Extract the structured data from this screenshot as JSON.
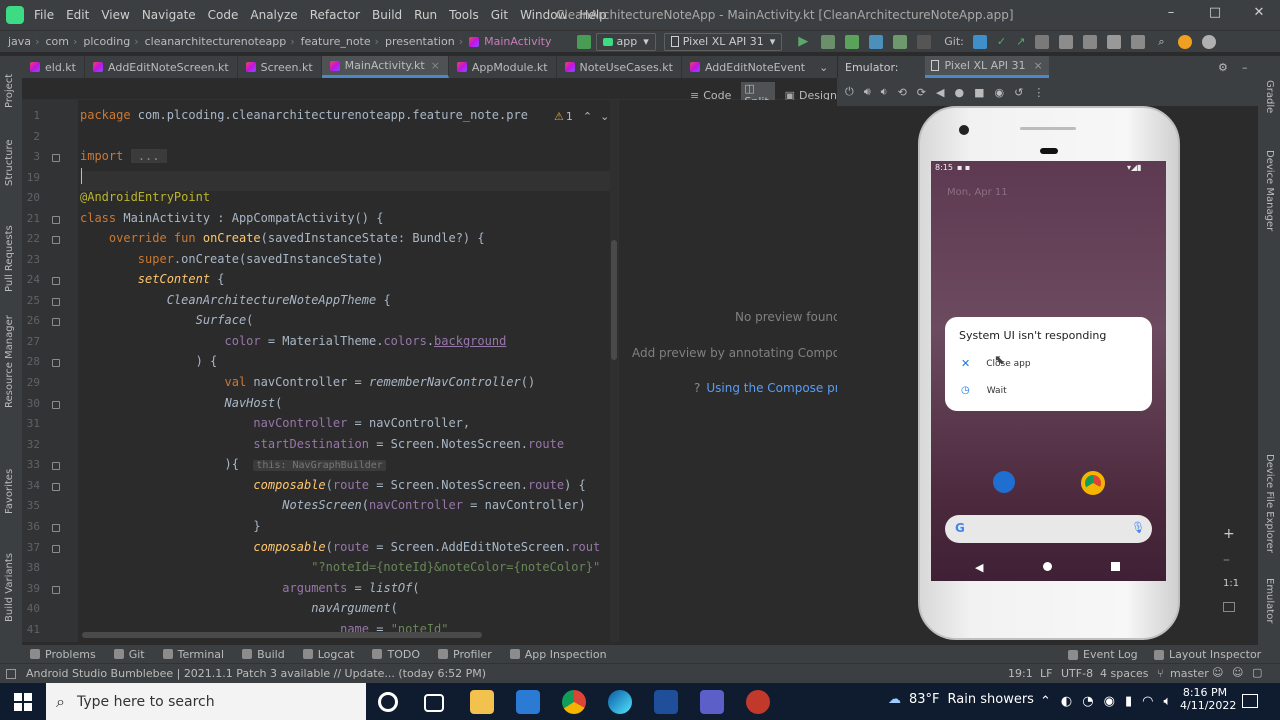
{
  "menu": {
    "items": [
      "File",
      "Edit",
      "View",
      "Navigate",
      "Code",
      "Analyze",
      "Refactor",
      "Build",
      "Run",
      "Tools",
      "Git",
      "Window",
      "Help"
    ],
    "window_title": "CleanArchitectureNoteApp - MainActivity.kt [CleanArchitectureNoteApp.app]"
  },
  "nav": {
    "breadcrumbs": [
      "java",
      "com",
      "plcoding",
      "cleanarchitecturenoteapp",
      "feature_note",
      "presentation",
      "MainActivity"
    ],
    "run_config": "app",
    "device": "Pixel XL API 31",
    "git_label": "Git:"
  },
  "tabs": [
    {
      "label": "eld.kt",
      "active": false
    },
    {
      "label": "AddEditNoteScreen.kt",
      "active": false
    },
    {
      "label": "Screen.kt",
      "active": false
    },
    {
      "label": "MainActivity.kt",
      "active": true
    },
    {
      "label": "AppModule.kt",
      "active": false
    },
    {
      "label": "NoteUseCases.kt",
      "active": false
    },
    {
      "label": "AddEditNoteEvent",
      "active": false
    }
  ],
  "view_modes": {
    "code": "Code",
    "split": "Split",
    "design": "Design"
  },
  "editor": {
    "warning_count": "1",
    "line_numbers": [
      "1",
      "2",
      "3",
      "19",
      "20",
      "21",
      "22",
      "23",
      "24",
      "25",
      "26",
      "27",
      "28",
      "29",
      "30",
      "31",
      "32",
      "33",
      "34",
      "35",
      "36",
      "37",
      "38",
      "39",
      "40",
      "41"
    ],
    "hint": "this: NavGraphBuilder"
  },
  "preview": {
    "no_preview": "No preview found.",
    "add_preview": "Add preview by annotating Composal",
    "link": "Using the Compose pr"
  },
  "emulator": {
    "label": "Emulator:",
    "device_tab": "Pixel XL API 31",
    "time": "8:15",
    "date": "Mon, Apr 11",
    "dialog_title": "System UI isn't responding",
    "close_app": "Close app",
    "wait": "Wait",
    "zoom_ratio": "1:1"
  },
  "left_strip": [
    "Project",
    "Structure",
    "Pull Requests",
    "Resource Manager",
    "Favorites",
    "Build Variants"
  ],
  "right_strip": [
    "Gradle",
    "Device Manager",
    "Device File Explorer",
    "Emulator"
  ],
  "tool_windows": [
    "Problems",
    "Git",
    "Terminal",
    "Build",
    "Logcat",
    "TODO",
    "Profiler",
    "App Inspection"
  ],
  "tool_windows_right": [
    "Event Log",
    "Layout Inspector"
  ],
  "status": {
    "message": "Android Studio Bumblebee | 2021.1.1 Patch 3 available // Update... (today 6:52 PM)",
    "position": "19:1",
    "line_sep": "LF",
    "encoding": "UTF-8",
    "indent": "4 spaces",
    "branch": "master"
  },
  "taskbar": {
    "search_placeholder": "Type here to search",
    "weather_temp": "83°F",
    "weather_desc": "Rain showers",
    "time": "8:16 PM",
    "date": "4/11/2022"
  },
  "colors": {
    "accent": "#4a88c7",
    "android_green": "#3ddc84",
    "keyword": "#cc7832",
    "annotation": "#bbb529",
    "function": "#ffc66d",
    "property": "#9876aa",
    "string": "#6a8759",
    "text": "#a9b7c6"
  }
}
